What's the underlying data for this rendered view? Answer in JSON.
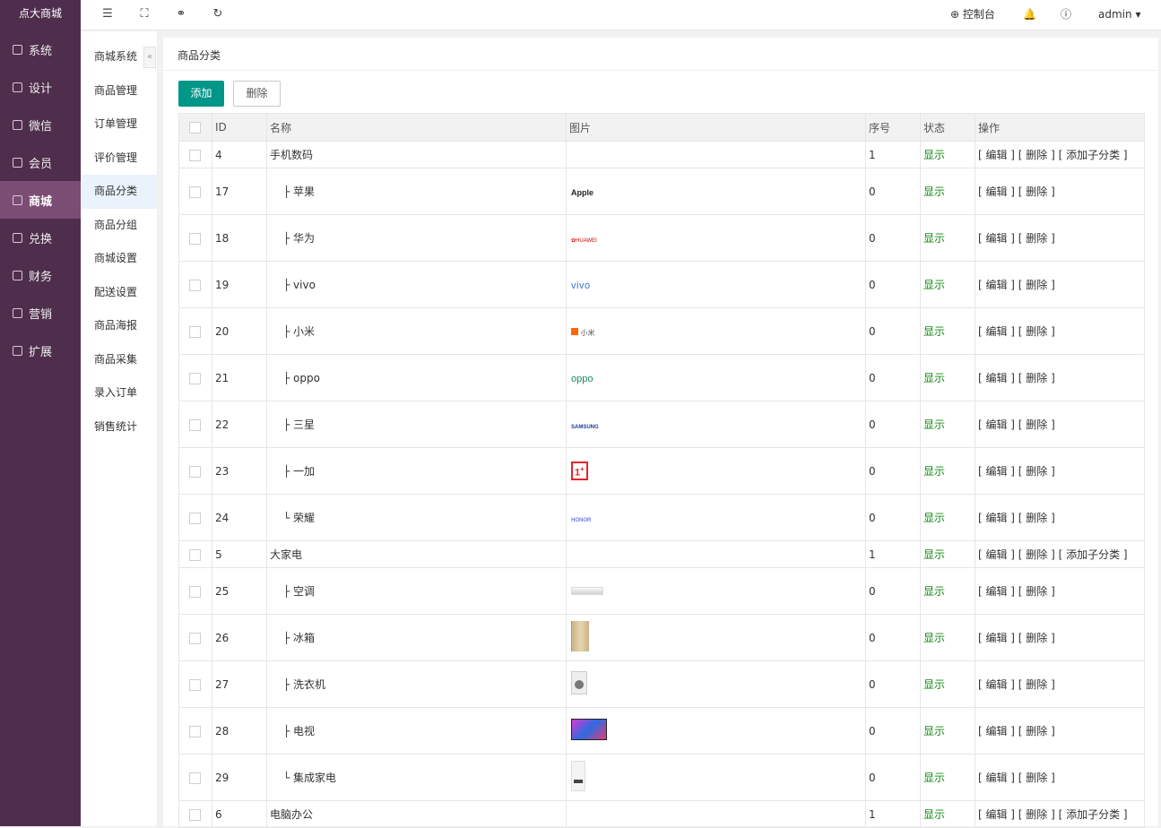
{
  "brand": "点大商城",
  "left_nav": [
    {
      "label": "系统",
      "icon": "settings-icon"
    },
    {
      "label": "设计",
      "icon": "design-icon"
    },
    {
      "label": "微信",
      "icon": "wechat-icon"
    },
    {
      "label": "会员",
      "icon": "member-icon"
    },
    {
      "label": "商城",
      "icon": "shop-icon"
    },
    {
      "label": "兑换",
      "icon": "exchange-icon"
    },
    {
      "label": "财务",
      "icon": "finance-icon"
    },
    {
      "label": "营销",
      "icon": "gift-icon"
    },
    {
      "label": "扩展",
      "icon": "grid-icon"
    }
  ],
  "active_nav": "商城",
  "topbar": {
    "console": "控制台",
    "user": "admin"
  },
  "sub_nav": [
    "商城系统",
    "商品管理",
    "订单管理",
    "评价管理",
    "商品分类",
    "商品分组",
    "商城设置",
    "配送设置",
    "商品海报",
    "商品采集",
    "录入订单",
    "销售统计"
  ],
  "active_sub": "商品分类",
  "page_title": "商品分类",
  "buttons": {
    "add": "添加",
    "delete": "删除"
  },
  "table": {
    "headers": [
      "ID",
      "名称",
      "图片",
      "序号",
      "状态",
      "操作"
    ],
    "rows": [
      {
        "id": "4",
        "name": "手机数码",
        "level": "parent",
        "image": "",
        "sort": "1",
        "status": "显示",
        "ops": "[ 编辑 ] [ 删除 ] [ 添加子分类 ]"
      },
      {
        "id": "17",
        "name": "├ 苹果",
        "level": "child",
        "image": "Apple",
        "sort": "0",
        "status": "显示",
        "ops": "[ 编辑 ] [ 删除 ]"
      },
      {
        "id": "18",
        "name": "├ 华为",
        "level": "child",
        "image": "HUAWEI",
        "sort": "0",
        "status": "显示",
        "ops": "[ 编辑 ] [ 删除 ]"
      },
      {
        "id": "19",
        "name": "├ vivo",
        "level": "child",
        "image": "vivo",
        "sort": "0",
        "status": "显示",
        "ops": "[ 编辑 ] [ 删除 ]"
      },
      {
        "id": "20",
        "name": "├ 小米",
        "level": "child",
        "image": "小米",
        "sort": "0",
        "status": "显示",
        "ops": "[ 编辑 ] [ 删除 ]"
      },
      {
        "id": "21",
        "name": "├ oppo",
        "level": "child",
        "image": "oppo",
        "sort": "0",
        "status": "显示",
        "ops": "[ 编辑 ] [ 删除 ]"
      },
      {
        "id": "22",
        "name": "├ 三星",
        "level": "child",
        "image": "SAMSUNG",
        "sort": "0",
        "status": "显示",
        "ops": "[ 编辑 ] [ 删除 ]"
      },
      {
        "id": "23",
        "name": "├ 一加",
        "level": "child",
        "image": "1+",
        "sort": "0",
        "status": "显示",
        "ops": "[ 编辑 ] [ 删除 ]"
      },
      {
        "id": "24",
        "name": "└ 荣耀",
        "level": "child",
        "image": "HONOR",
        "sort": "0",
        "status": "显示",
        "ops": "[ 编辑 ] [ 删除 ]"
      },
      {
        "id": "5",
        "name": "大家电",
        "level": "parent",
        "image": "",
        "sort": "1",
        "status": "显示",
        "ops": "[ 编辑 ] [ 删除 ] [ 添加子分类 ]"
      },
      {
        "id": "25",
        "name": "├ 空调",
        "level": "child",
        "image": "ac",
        "sort": "0",
        "status": "显示",
        "ops": "[ 编辑 ] [ 删除 ]"
      },
      {
        "id": "26",
        "name": "├ 冰箱",
        "level": "child",
        "image": "fridge",
        "sort": "0",
        "status": "显示",
        "ops": "[ 编辑 ] [ 删除 ]"
      },
      {
        "id": "27",
        "name": "├ 洗衣机",
        "level": "child",
        "image": "washer",
        "sort": "0",
        "status": "显示",
        "ops": "[ 编辑 ] [ 删除 ]"
      },
      {
        "id": "28",
        "name": "├ 电视",
        "level": "child",
        "image": "tv",
        "sort": "0",
        "status": "显示",
        "ops": "[ 编辑 ] [ 删除 ]"
      },
      {
        "id": "29",
        "name": "└ 集成家电",
        "level": "child",
        "image": "appliance",
        "sort": "0",
        "status": "显示",
        "ops": "[ 编辑 ] [ 删除 ]"
      },
      {
        "id": "6",
        "name": "电脑办公",
        "level": "parent",
        "image": "",
        "sort": "1",
        "status": "显示",
        "ops": "[ 编辑 ] [ 删除 ] [ 添加子分类 ]"
      }
    ]
  }
}
